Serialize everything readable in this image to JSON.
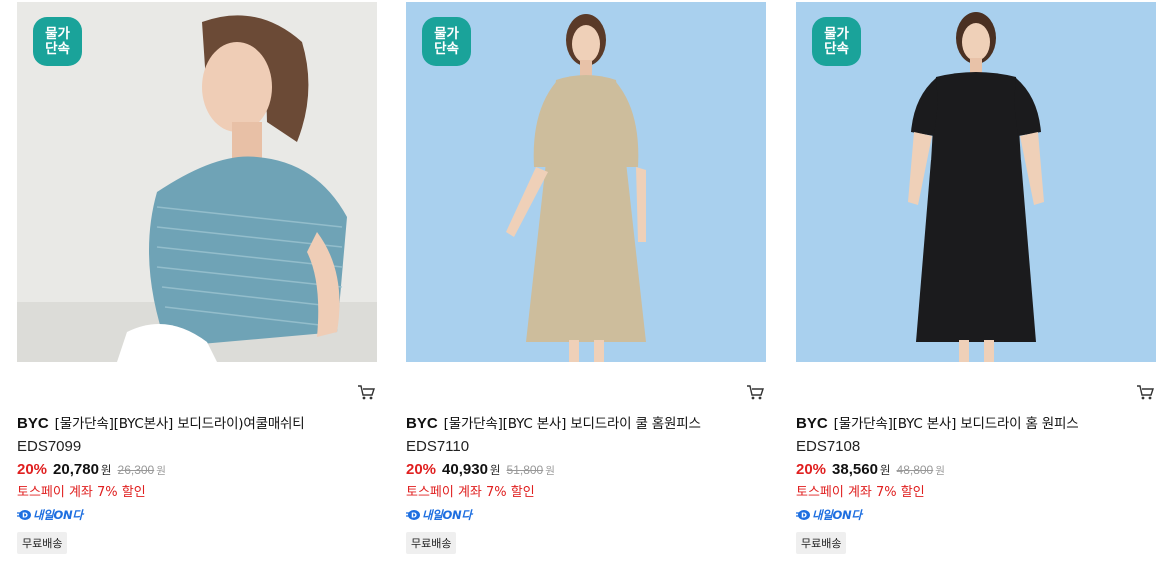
{
  "products": [
    {
      "badge": "물가\n단속",
      "brand": "BYC",
      "name": "[물가단속][BYC본사] 보디드라이)여쿨매쉬티",
      "code": "EDS7099",
      "discount": "20%",
      "price": "20,780",
      "currency": "원",
      "original_price": "26,300",
      "original_currency": "원",
      "promo": "토스페이 계좌 7% 할인",
      "delivery": "내일ON다",
      "shipping": "무료배송",
      "image_bg": "#e9e9e6",
      "garment_color": "#6fa3b6"
    },
    {
      "badge": "물가\n단속",
      "brand": "BYC",
      "name": "[물가단속][BYC 본사] 보디드라이 쿨 홈원피스",
      "code": "EDS7110",
      "discount": "20%",
      "price": "40,930",
      "currency": "원",
      "original_price": "51,800",
      "original_currency": "원",
      "promo": "토스페이 계좌 7% 할인",
      "delivery": "내일ON다",
      "shipping": "무료배송",
      "image_bg": "#a9d0ee",
      "garment_color": "#cdbd9c"
    },
    {
      "badge": "물가\n단속",
      "brand": "BYC",
      "name": "[물가단속][BYC 본사] 보디드라이 홈 원피스",
      "code": "EDS7108",
      "discount": "20%",
      "price": "38,560",
      "currency": "원",
      "original_price": "48,800",
      "original_currency": "원",
      "promo": "토스페이 계좌 7% 할인",
      "delivery": "내일ON다",
      "shipping": "무료배송",
      "image_bg": "#a9d0ee",
      "garment_color": "#1b1b1d"
    }
  ],
  "colors": {
    "badge": "#1aa39a",
    "discount": "#e02020",
    "delivery": "#1e6fe0"
  }
}
